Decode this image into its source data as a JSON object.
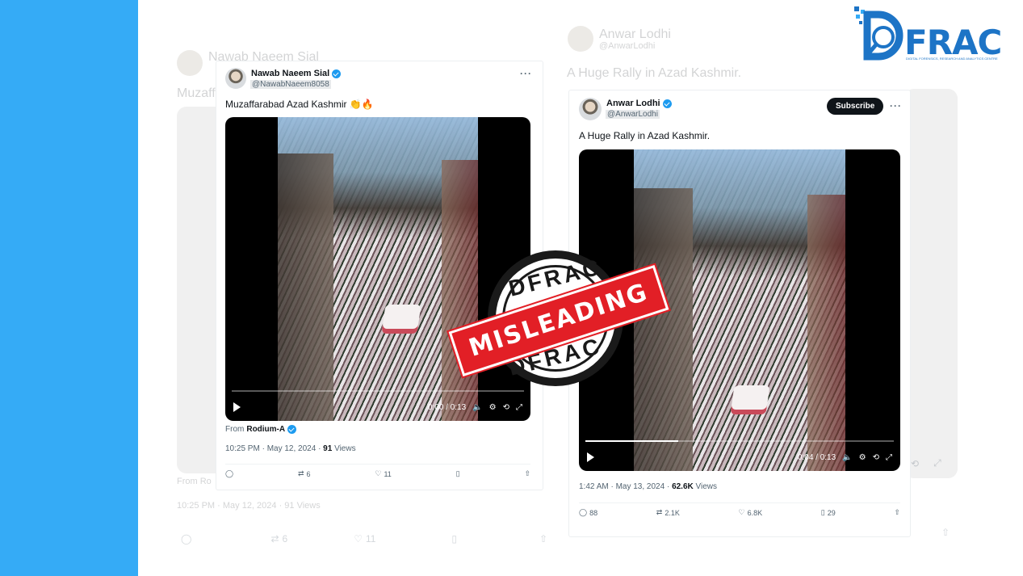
{
  "logo": {
    "wordmark": "FRAC",
    "tagline": "DIGITAL FORENSICS, RESEARCH AND ANALYTICS CENTRE",
    "brand_color": "#1d74c6"
  },
  "ghost_left": {
    "name": "Nawab Naeem Sial",
    "text": "Muzaffa",
    "from": "From Ro",
    "timestamp": "10:25 PM · May 12, 2024 · 91 Views",
    "retweets": "6",
    "likes": "11"
  },
  "ghost_right": {
    "name": "Anwar Lodhi",
    "handle": "@AnwarLodhi",
    "text": "A Huge Rally in Azad Kashmir."
  },
  "tweet_left": {
    "name": "Nawab Naeem Sial",
    "handle": "@NawabNaeem8058",
    "text": "Muzaffarabad Azad Kashmir 👏🔥",
    "video_time": "0:00 / 0:13",
    "progress": 0.0,
    "from_label": "From",
    "from_source": "Rodium-A",
    "time": "10:25 PM · May 12, 2024 · ",
    "views_count": "91",
    "views_label": " Views",
    "retweets": "6",
    "likes": "11"
  },
  "tweet_right": {
    "name": "Anwar Lodhi",
    "handle": "@AnwarLodhi",
    "subscribe_label": "Subscribe",
    "text": "A Huge Rally in Azad Kashmir.",
    "video_time": "0:04 / 0:13",
    "progress": 0.3,
    "time": "1:42 AM · May 13, 2024 · ",
    "views_count": "62.6K",
    "views_label": " Views",
    "replies": "88",
    "retweets": "2.1K",
    "likes": "6.8K",
    "bookmarks": "29"
  },
  "stamp": {
    "top": "DFRAC",
    "bottom": "DFRAC",
    "label": "MISLEADING",
    "label_color": "#e21f26"
  }
}
